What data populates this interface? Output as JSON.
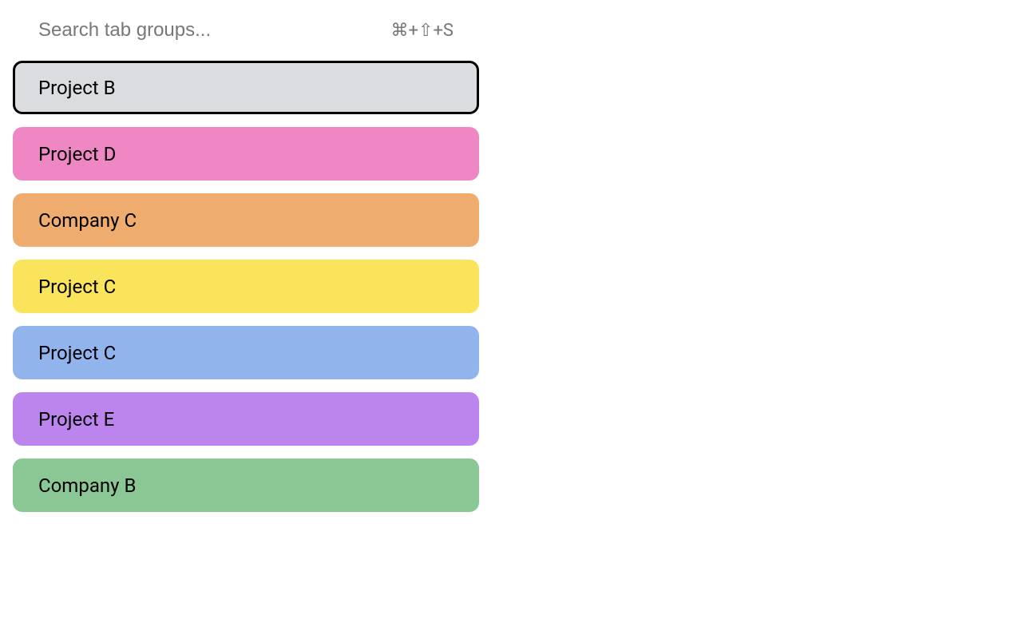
{
  "search": {
    "placeholder": "Search tab groups...",
    "shortcut": "⌘+⇧+S"
  },
  "groups": [
    {
      "label": "Project B",
      "color": "#dadce0",
      "selected": true
    },
    {
      "label": "Project D",
      "color": "#ee87c4",
      "selected": false
    },
    {
      "label": "Company C",
      "color": "#eeac6f",
      "selected": false
    },
    {
      "label": "Project C",
      "color": "#fae45b",
      "selected": false
    },
    {
      "label": "Project C",
      "color": "#92b4ed",
      "selected": false
    },
    {
      "label": "Project E",
      "color": "#bb85ed",
      "selected": false
    },
    {
      "label": "Company B",
      "color": "#8bc795",
      "selected": false
    }
  ]
}
